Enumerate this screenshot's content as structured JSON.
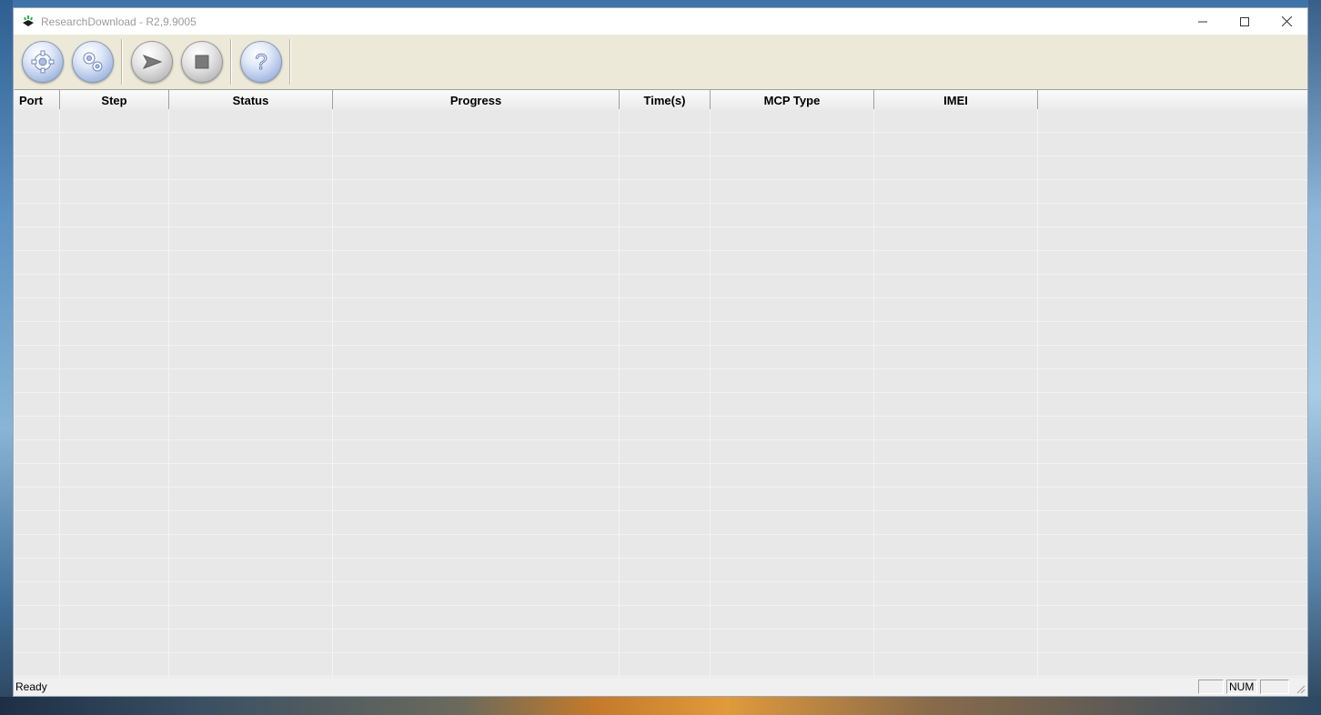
{
  "window": {
    "title": "ResearchDownload - R2,9.9005"
  },
  "window_controls": [
    "minimize-icon",
    "maximize-icon",
    "close-icon"
  ],
  "toolbar": {
    "buttons": [
      {
        "name": "load-packet-button",
        "icon": "gear-icon"
      },
      {
        "name": "settings-button",
        "icon": "gears-icon"
      },
      {
        "name": "start-download-button",
        "icon": "play-arrow-icon"
      },
      {
        "name": "stop-download-button",
        "icon": "stop-icon"
      },
      {
        "name": "help-button",
        "icon": "question-icon"
      }
    ]
  },
  "table": {
    "columns": [
      "Port",
      "Step",
      "Status",
      "Progress",
      "Time(s)",
      "MCP Type",
      "IMEI"
    ]
  },
  "statusbar": {
    "text": "Ready",
    "panes": [
      "",
      "NUM",
      ""
    ]
  },
  "colors": {
    "toolbar_bg": "#ece9d8",
    "grid_bg": "#e8e8e8",
    "button_blue": "#a9bde4"
  }
}
